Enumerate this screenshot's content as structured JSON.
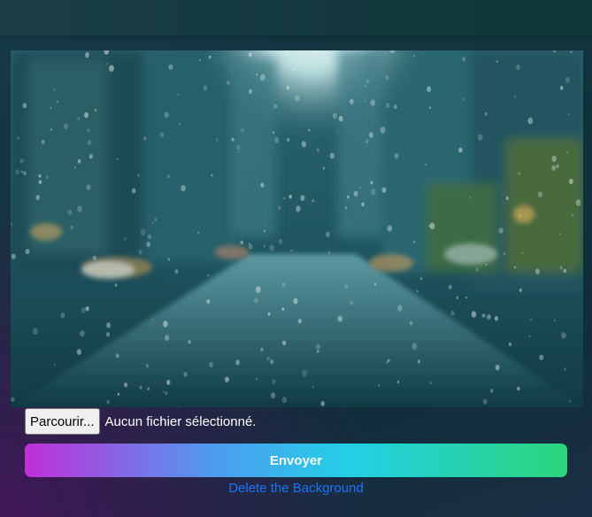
{
  "image": {
    "description_icon": "rainy-city-street-photo"
  },
  "upload": {
    "browse_label": "Parcourir...",
    "status_text": "Aucun fichier sélectionné."
  },
  "actions": {
    "submit_label": "Envoyer",
    "delete_label": "Delete the Background"
  },
  "colors": {
    "gradient_start": "#c02fd8",
    "gradient_mid": "#22d0e6",
    "gradient_end": "#2ad47a",
    "link": "#1a73ff"
  }
}
